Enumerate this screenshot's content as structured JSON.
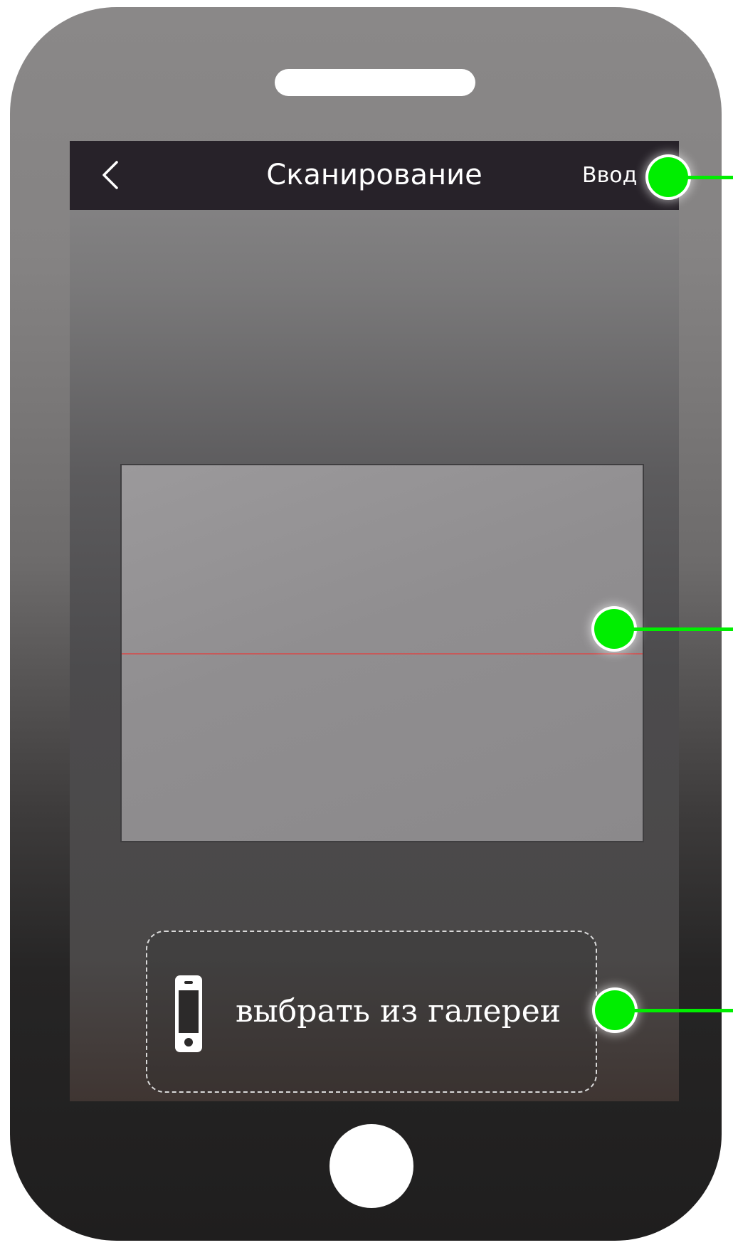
{
  "header": {
    "title": "Сканирование",
    "action_label": "Ввод",
    "back_icon": "chevron-left-icon"
  },
  "scanner": {
    "line_color": "#c65a5a"
  },
  "gallery": {
    "label": "выбрать из галереи",
    "icon": "smartphone-icon"
  },
  "colors": {
    "navbar": "#272229",
    "marker": "#00ee00",
    "text": "#ffffff"
  }
}
